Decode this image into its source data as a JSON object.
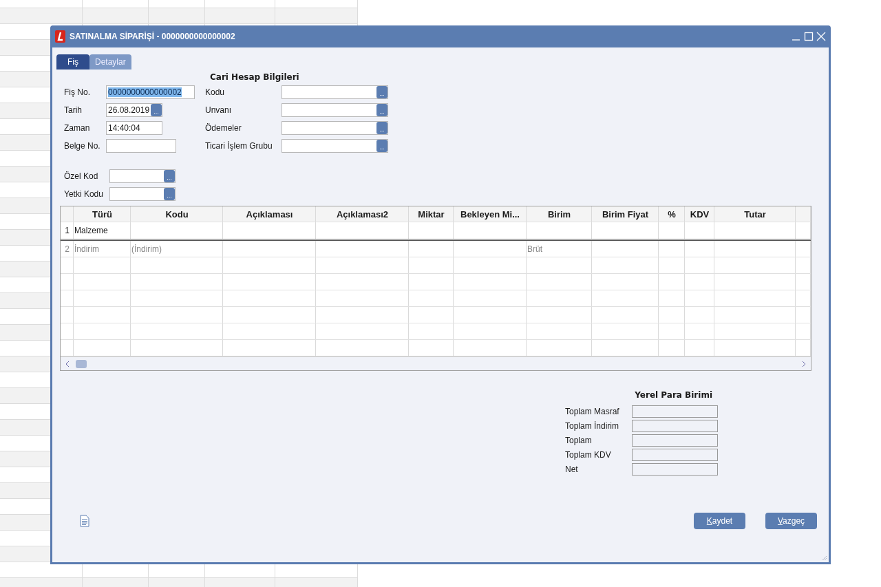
{
  "window": {
    "title": "SATINALMA SİPARİŞİ - 0000000000000002"
  },
  "tabs": [
    {
      "label": "Fiş",
      "selected": true
    },
    {
      "label": "Detaylar",
      "selected": false
    }
  ],
  "header_fields": [
    {
      "label": "Fiş No.",
      "value": "0000000000000002",
      "text_selected": true
    },
    {
      "label": "Tarih",
      "value": "26.08.2019",
      "text_selected": false,
      "button": "..."
    },
    {
      "label": "Zaman",
      "value": "14:40:04",
      "text_selected": false
    },
    {
      "label": "Belge No."
    }
  ],
  "cari_hesap": {
    "title": "Cari Hesap Bilgileri",
    "fields": [
      {
        "label": "Kodu",
        "button": "..."
      },
      {
        "label": "Unvanı",
        "button": "..."
      },
      {
        "label": "Ödemeler",
        "button": "..."
      },
      {
        "label": "Ticari İşlem Grubu",
        "button": "..."
      }
    ]
  },
  "code_fields": [
    {
      "label": "Özel Kod",
      "button": "..."
    },
    {
      "label": "Yetki Kodu",
      "button": "..."
    }
  ],
  "table": {
    "columns": [
      "Türü",
      "Kodu",
      "Açıklaması",
      "Açıklaması2",
      "Miktar",
      "Bekleyen Mi...",
      "Birim",
      "Birim Fiyat",
      "%",
      "KDV",
      "Tutar"
    ],
    "rows": [
      {
        "number": "1",
        "turu": "Malzeme",
        "dimmed": false
      },
      {
        "number": "2",
        "turu": "İndirim",
        "kodu": "(İndirim)",
        "birim": "Brüt",
        "dimmed": true
      }
    ]
  },
  "totals": {
    "title": "Yerel Para Birimi",
    "fields": [
      {
        "label": "Toplam Masraf"
      },
      {
        "label": "Toplam İndirim"
      },
      {
        "label": "Toplam"
      },
      {
        "label": "Toplam KDV"
      },
      {
        "label": "Net"
      }
    ]
  },
  "buttons": [
    {
      "label": "Kaydet"
    },
    {
      "label": "Vazgeç"
    }
  ]
}
